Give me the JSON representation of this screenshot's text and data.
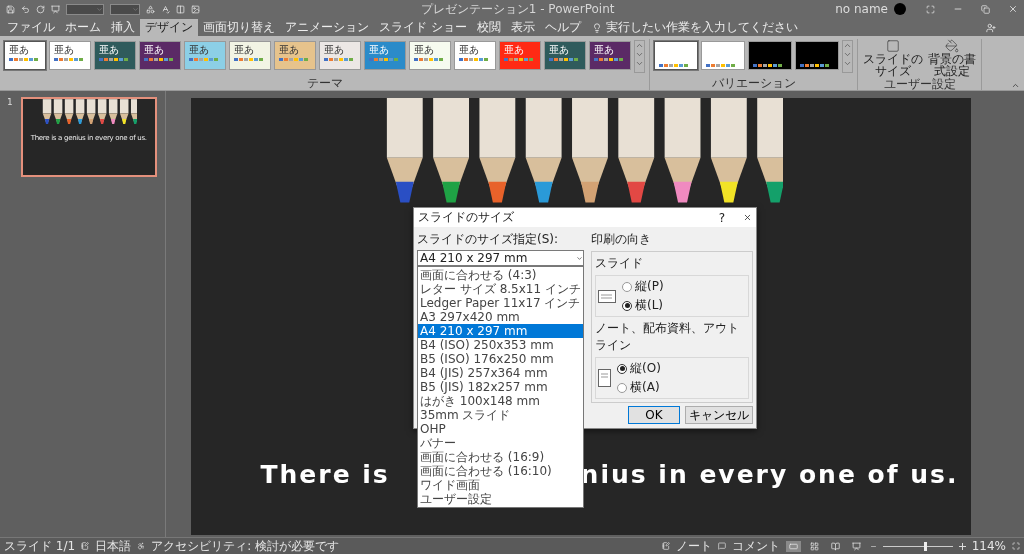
{
  "title_bar": {
    "title": "プレゼンテーション1  -  PowerPoint",
    "user": "no name"
  },
  "tabs": [
    {
      "label": "ファイル",
      "selected": false
    },
    {
      "label": "ホーム",
      "selected": false
    },
    {
      "label": "挿入",
      "selected": false
    },
    {
      "label": "デザイン",
      "selected": true
    },
    {
      "label": "画面切り替え",
      "selected": false
    },
    {
      "label": "アニメーション",
      "selected": false
    },
    {
      "label": "スライド ショー",
      "selected": false
    },
    {
      "label": "校閲",
      "selected": false
    },
    {
      "label": "表示",
      "selected": false
    },
    {
      "label": "ヘルプ",
      "selected": false
    }
  ],
  "tell_me": {
    "placeholder": "実行したい作業を入力してください"
  },
  "ribbon": {
    "themes": {
      "label": "テーマ",
      "items": [
        {
          "text": "亜あ",
          "color": "#ffffff",
          "selected": true
        },
        {
          "text": "亜あ",
          "color": "#ffffff",
          "selected": false
        },
        {
          "text": "亜あ",
          "color": "#2f5b5c",
          "selected": false
        },
        {
          "text": "亜あ",
          "color": "#5b2a66",
          "selected": false
        },
        {
          "text": "亜あ",
          "color": "#8ccfe6",
          "selected": false
        },
        {
          "text": "亜あ",
          "color": "#f2f4e4",
          "selected": false
        },
        {
          "text": "亜あ",
          "color": "#e6c38c",
          "selected": false
        },
        {
          "text": "亜あ",
          "color": "#ece7e5",
          "selected": false
        },
        {
          "text": "亜あ",
          "color": "#2b8bc9",
          "selected": false
        },
        {
          "text": "亜あ",
          "color": "#f6fbef",
          "selected": false
        },
        {
          "text": "亜あ",
          "color": "#ffffff",
          "selected": false
        },
        {
          "text": "亜あ",
          "color": "#ff2a14",
          "selected": false
        },
        {
          "text": "亜あ",
          "color": "#2f5b5c",
          "selected": false
        },
        {
          "text": "亜あ",
          "color": "#5b2a66",
          "selected": false
        }
      ]
    },
    "variants": {
      "label": "バリエーション",
      "items": [
        {
          "color": "#ffffff",
          "selected": true
        },
        {
          "color": "#ffffff",
          "selected": false
        },
        {
          "color": "#000000",
          "selected": false
        },
        {
          "color": "#000000",
          "selected": false
        }
      ]
    },
    "customize": {
      "label": "ユーザー設定",
      "buttons": [
        {
          "kind": "size",
          "lines": [
            "スライドの",
            "サイズ"
          ]
        },
        {
          "kind": "background",
          "lines": [
            "背景の書",
            "式設定"
          ]
        }
      ]
    }
  },
  "slides_panel": {
    "slides": [
      {
        "number": "1",
        "selected": true,
        "caption": "There is a genius in every one of us."
      }
    ]
  },
  "slide": {
    "caption_parts": [
      "There is",
      "nius in every one of us."
    ]
  },
  "dialog": {
    "title": "スライドのサイズ",
    "help": "?",
    "size_label": "スライドのサイズ指定(S):",
    "size_value": "A4 210 x 297 mm",
    "size_options": [
      {
        "label": "画面に合わせる (4:3)",
        "selected": false
      },
      {
        "label": "レター サイズ 8.5x11 インチ",
        "selected": false
      },
      {
        "label": "Ledger Paper 11x17 インチ",
        "selected": false
      },
      {
        "label": "A3 297x420 mm",
        "selected": false
      },
      {
        "label": "A4 210 x 297 mm",
        "selected": true
      },
      {
        "label": "B4 (ISO) 250x353 mm",
        "selected": false
      },
      {
        "label": "B5 (ISO) 176x250 mm",
        "selected": false
      },
      {
        "label": "B4 (JIS) 257x364 mm",
        "selected": false
      },
      {
        "label": "B5 (JIS) 182x257 mm",
        "selected": false
      },
      {
        "label": "はがき 100x148 mm",
        "selected": false
      },
      {
        "label": "35mm スライド",
        "selected": false
      },
      {
        "label": "OHP",
        "selected": false
      },
      {
        "label": "バナー",
        "selected": false
      },
      {
        "label": "画面に合わせる (16:9)",
        "selected": false
      },
      {
        "label": "画面に合わせる (16:10)",
        "selected": false
      },
      {
        "label": "ワイド画面",
        "selected": false
      },
      {
        "label": "ユーザー設定",
        "selected": false
      }
    ],
    "orientation_label": "印刷の向き",
    "groups": [
      {
        "label": "スライド",
        "kind": "landscape",
        "options": [
          {
            "label": "縦(P)",
            "selected": false
          },
          {
            "label": "横(L)",
            "selected": true
          }
        ]
      },
      {
        "label": "ノート、配布資料、アウトライン",
        "kind": "portrait",
        "options": [
          {
            "label": "縦(O)",
            "selected": true
          },
          {
            "label": "横(A)",
            "selected": false
          }
        ]
      }
    ],
    "buttons": [
      "OK",
      "キャンセル"
    ]
  },
  "status_bar": {
    "slide": "スライド 1/1",
    "language": "日本語",
    "accessibility": "アクセシビリティ: 検討が必要です",
    "notes": "ノート",
    "comments": "コメント",
    "views": [
      {
        "kind": "normal",
        "selected": true
      },
      {
        "kind": "sorter",
        "selected": false
      },
      {
        "kind": "reading",
        "selected": false
      },
      {
        "kind": "show",
        "selected": false
      }
    ],
    "zoom": {
      "level": 0.6,
      "reading": "114%"
    }
  }
}
